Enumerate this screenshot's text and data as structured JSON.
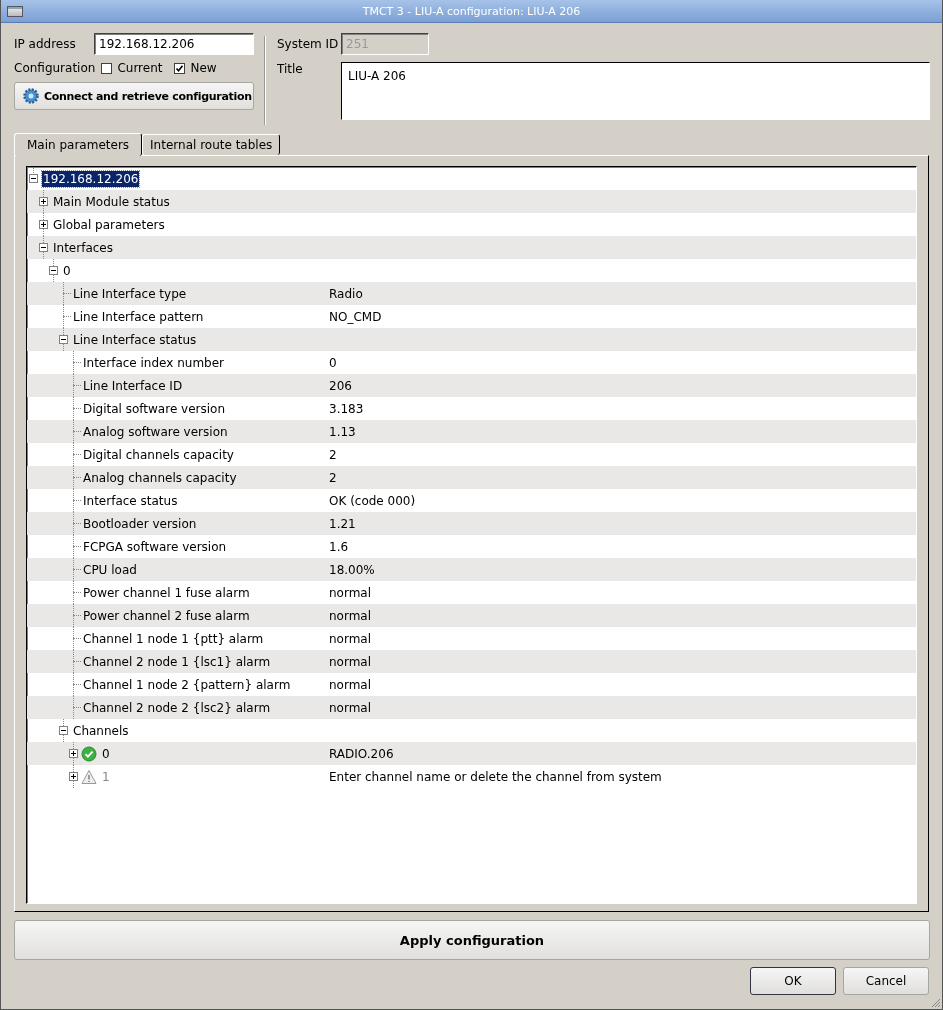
{
  "window": {
    "title": "TMCT 3 - LIU-A configuration: LIU-A 206"
  },
  "connection": {
    "ip_label": "IP address",
    "ip_value": "192.168.12.206",
    "configuration_label": "Configuration",
    "options": [
      {
        "label": "Current",
        "checked": false
      },
      {
        "label": "New",
        "checked": true
      }
    ],
    "connect_button": "Connect and retrieve configuration"
  },
  "system": {
    "system_id_label": "System ID",
    "system_id_value": "251",
    "system_id_disabled": true,
    "title_label": "Title",
    "title_value": "LIU-A 206"
  },
  "tabs": [
    {
      "label": "Main parameters",
      "selected": true
    },
    {
      "label": "Internal route tables",
      "selected": false
    }
  ],
  "tree": {
    "nodes": [
      {
        "label": "192.168.12.206",
        "selected": true,
        "expanded": true,
        "children": [
          {
            "label": "Main Module status",
            "selected": false,
            "expanded": false
          },
          {
            "label": "Global parameters",
            "selected": false,
            "expanded": false
          },
          {
            "label": "Interfaces",
            "selected": false,
            "expanded": true,
            "children": [
              {
                "label": "0",
                "selected": false,
                "expanded": true,
                "children": [
                  {
                    "label": "Line Interface type",
                    "value": "Radio",
                    "selected": false
                  },
                  {
                    "label": "Line Interface pattern",
                    "value": "NO_CMD",
                    "selected": false
                  },
                  {
                    "label": "Line Interface status",
                    "selected": false,
                    "expanded": true,
                    "children": [
                      {
                        "label": "Interface index number",
                        "value": "0",
                        "selected": false
                      },
                      {
                        "label": "Line Interface ID",
                        "value": "206",
                        "selected": false
                      },
                      {
                        "label": "Digital software version",
                        "value": "3.183",
                        "selected": false
                      },
                      {
                        "label": "Analog software version",
                        "value": "1.13",
                        "selected": false
                      },
                      {
                        "label": "Digital channels capacity",
                        "value": "2",
                        "selected": false
                      },
                      {
                        "label": "Analog channels capacity",
                        "value": "2",
                        "selected": false
                      },
                      {
                        "label": "Interface status",
                        "value": "OK (code 000)",
                        "selected": false
                      },
                      {
                        "label": "Bootloader version",
                        "value": "1.21",
                        "selected": false
                      },
                      {
                        "label": "FCPGA software version",
                        "value": "1.6",
                        "selected": false
                      },
                      {
                        "label": "CPU load",
                        "value": "18.00%",
                        "selected": false
                      },
                      {
                        "label": "Power channel 1 fuse alarm",
                        "value": "normal",
                        "selected": false
                      },
                      {
                        "label": "Power channel 2 fuse alarm",
                        "value": "normal",
                        "selected": false
                      },
                      {
                        "label": "Channel 1 node 1 {ptt} alarm",
                        "value": "normal",
                        "selected": false
                      },
                      {
                        "label": "Channel 2 node 1 {lsc1} alarm",
                        "value": "normal",
                        "selected": false
                      },
                      {
                        "label": "Channel 1 node 2 {pattern} alarm",
                        "value": "normal",
                        "selected": false
                      },
                      {
                        "label": "Channel 2 node 2 {lsc2} alarm",
                        "value": "normal",
                        "selected": false
                      }
                    ]
                  },
                  {
                    "label": "Channels",
                    "selected": false,
                    "expanded": true,
                    "children": [
                      {
                        "label": "0",
                        "value": "RADIO.206",
                        "selected": false,
                        "expanded": false,
                        "kind": "ok",
                        "disabled": false
                      },
                      {
                        "label": "1",
                        "value": "Enter channel name or delete the channel from system",
                        "selected": false,
                        "expanded": false,
                        "kind": "warning",
                        "disabled": true
                      }
                    ]
                  }
                ]
              }
            ]
          }
        ]
      }
    ]
  },
  "apply_button": "Apply configuration",
  "buttons": [
    {
      "label": "OK",
      "default": true
    },
    {
      "label": "Cancel",
      "default": false
    }
  ]
}
